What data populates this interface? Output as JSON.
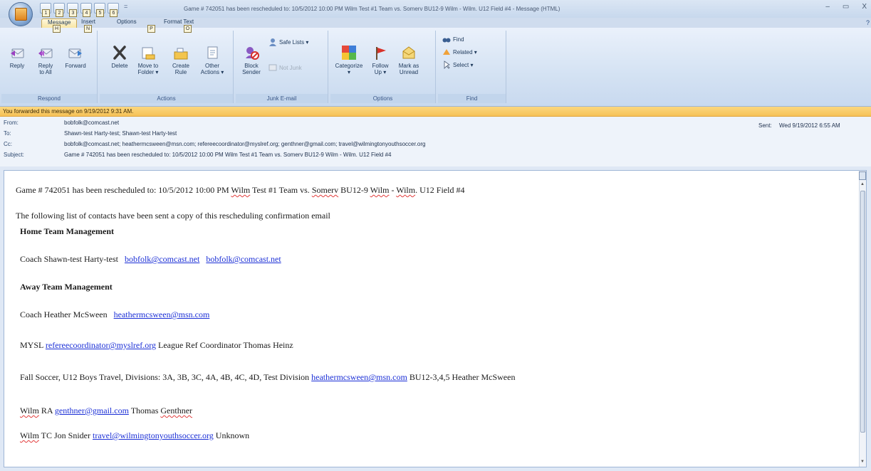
{
  "window": {
    "title": "Game # 742051 has been rescheduled to: 10/5/2012 10:00 PM Wilm Test #1 Team vs. Somerv BU12-9 Wilm - Wilm. U12 Field #4 - Message (HTML)",
    "minimize_glyph": "–",
    "maximize_glyph": "▭",
    "close_glyph": "X"
  },
  "quick_access": {
    "keytips": [
      "1",
      "2",
      "3",
      "4",
      "5",
      "6"
    ],
    "more_glyph": "="
  },
  "tabs": [
    {
      "label": "Message",
      "keytip": "H"
    },
    {
      "label": "Insert",
      "keytip": "N"
    },
    {
      "label": "Options",
      "keytip": "P"
    },
    {
      "label": "Format Text",
      "keytip": "O"
    }
  ],
  "help_glyph": "?",
  "ribbon": {
    "respond": {
      "label": "Respond",
      "reply": "Reply",
      "reply_all_1": "Reply",
      "reply_all_2": "to All",
      "forward": "Forward"
    },
    "actions": {
      "label": "Actions",
      "delete": "Delete",
      "move_1": "Move to",
      "move_2": "Folder ▾",
      "create_1": "Create",
      "create_2": "Rule",
      "other_1": "Other",
      "other_2": "Actions ▾"
    },
    "junk": {
      "label": "Junk E-mail",
      "block_1": "Block",
      "block_2": "Sender",
      "safe_lists": "Safe Lists ▾",
      "not_junk": "Not Junk"
    },
    "options": {
      "label": "Options",
      "categorize": "Categorize",
      "categorize_arrow": "▾",
      "follow_1": "Follow",
      "follow_2": "Up ▾",
      "mark_1": "Mark as",
      "mark_2": "Unread"
    },
    "find": {
      "label": "Find",
      "find": "Find",
      "related": "Related ▾",
      "select": "Select ▾"
    },
    "launcher_glyph": "⌟"
  },
  "infobar": "You forwarded this message on 9/19/2012 9:31 AM.",
  "headers": {
    "from_label": "From:",
    "from": "bobfolk@comcast.net",
    "to_label": "To:",
    "to": "Shawn-test Harty-test; Shawn-test Harty-test",
    "cc_label": "Cc:",
    "cc": "bobfolk@comcast.net; heathermcsween@msn.com; refereecoordinator@myslref.org; genthner@gmail.com; travel@wilmingtonyouthsoccer.org",
    "subject_label": "Subject:",
    "subject": "Game # 742051 has been rescheduled to: 10/5/2012 10:00 PM Wilm Test #1 Team vs. Somerv BU12-9 Wilm - Wilm. U12 Field #4",
    "sent_label": "Sent:",
    "sent": "Wed 9/19/2012 6:55 AM"
  },
  "body": {
    "line1_a": "Game # 742051 has been rescheduled to: 10/5/2012 10:00 PM ",
    "line1_wilm": "Wilm",
    "line1_b": " Test #1 Team vs. ",
    "line1_somerv": "Somerv",
    "line1_c": " BU12-9 ",
    "line1_wilm2": "Wilm",
    "line1_d": " - ",
    "line1_wilm3": "Wilm",
    "line1_e": ". U12 Field #4",
    "line2": "The following list of contacts have been sent a copy of this rescheduling confirmation email",
    "home_heading": "Home Team Management",
    "home_coach": "Coach   Shawn-test Harty-test",
    "home_email1": "bobfolk@comcast.net",
    "home_email2": "bobfolk@comcast.net",
    "away_heading": "Away Team Management",
    "away_coach": "Coach   Heather McSween",
    "away_email": "heathermcsween@msn.com",
    "mysl_label": "MYSL",
    "mysl_email": "refereecoordinator@myslref.org",
    "mysl_text": "League Ref Coordinator Thomas Heinz",
    "fall_text": "Fall Soccer, U12 Boys Travel, Divisions: 3A, 3B, 3C, 4A, 4B, 4C, 4D, Test Division",
    "fall_email": "heathermcsween@msn.com",
    "fall_tail": "BU12-3,4,5 Heather McSween",
    "ra_wilm": "Wilm",
    "ra_label": " RA",
    "ra_email": "genthner@gmail.com",
    "ra_name_a": "Thomas ",
    "ra_name_b": "Genthner",
    "tc_wilm": "Wilm",
    "tc_label": " TC Jon Snider",
    "tc_email": "travel@wilmingtonyouthsoccer.org",
    "tc_tail": "Unknown"
  },
  "colors": {
    "link": "#1b2fd6",
    "infobar": "#f6c257",
    "ribbon": "#d4e2f3"
  }
}
